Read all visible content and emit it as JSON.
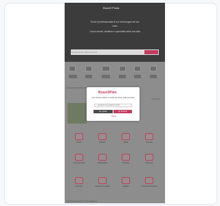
{
  "page": {
    "header": {
      "logo": "Bsaxi3 Posta",
      "hero_line1": "Trova il professionista di cui hai bisogno nel tuo",
      "hero_line2": "caso",
      "hero_line3": "Cerca servizi, strutture e specialisti della tua citta",
      "search_placeholder": "Cerca servizi nella tua zona"
    },
    "sections": {
      "category_title": "CATEGORIE PRINCIPALI - SERVIZI",
      "side_text": "Vedi tutte",
      "footer_text": "PROFESSIONISTI IN EVIDENZA"
    },
    "grid": {
      "items": [
        "Medici",
        "Dentisti",
        "Notai",
        "Avvocati",
        "Commercialisti",
        "Fisioterapisti",
        "Psicologi",
        "Veterinari",
        "Farmacie",
        "Assistenza anziani",
        "Artigiani",
        "Consulenti finanziari"
      ]
    },
    "modal": {
      "brand": "Bsaxi3Plan",
      "text": "Vuoi ricevere offerte e novita sui servizi della tua citta?",
      "email_placeholder": "Inserisci il tuo indirizzo email",
      "no_label": "No, grazie",
      "yes_label": "Si, iscrivimi",
      "close_label": "Chiudi"
    }
  }
}
